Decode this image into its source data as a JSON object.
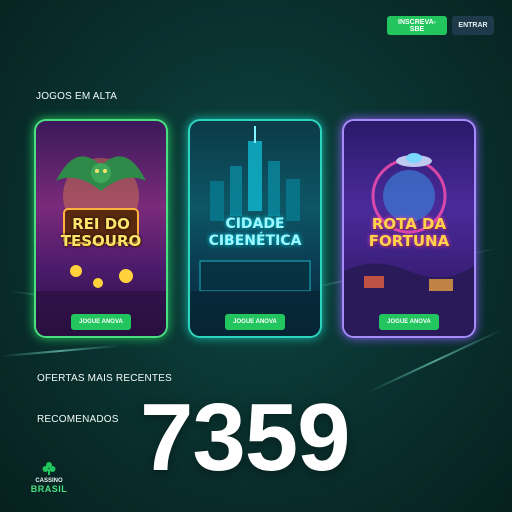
{
  "header": {
    "register_label": "INSCREVA-SBE",
    "login_label": "ENTRAR"
  },
  "sections": {
    "trending_title": "JOGOS EM ALTA",
    "offers_title": "OFERTAS MAIS RECENTES",
    "recommended_title": "RECOMENADOS"
  },
  "games": [
    {
      "title": "REI DO TESOURO",
      "button_label": "JOGUE ANOVA",
      "accent": "#4ade80"
    },
    {
      "title": "CIDADE CIBENÉTICA",
      "button_label": "JOGUE ANOVA",
      "accent": "#2dd4bf"
    },
    {
      "title": "ROTA DA FORTUNA",
      "button_label": "JOGUE ANOVA",
      "accent": "#a78bfa"
    }
  ],
  "big_number": "7359",
  "logo": {
    "top": "CASSINO",
    "bottom": "BRASIL"
  },
  "colors": {
    "primary_button": "#22c55e",
    "background": "#0a3431"
  }
}
